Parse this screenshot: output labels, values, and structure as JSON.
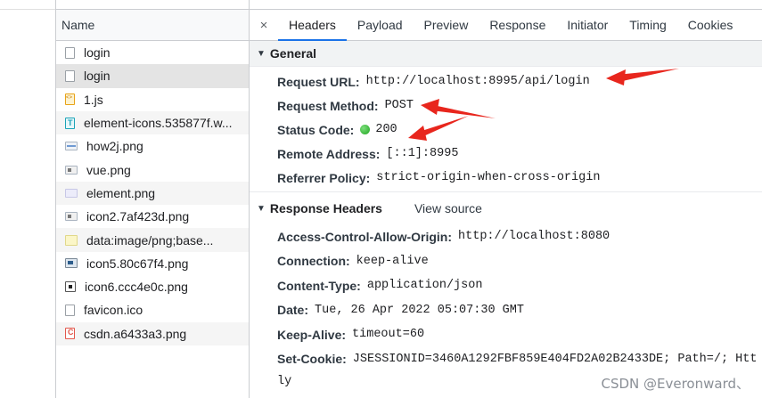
{
  "network_list": {
    "column_header": "Name",
    "items": [
      {
        "name": "login",
        "icon": "document-icon"
      },
      {
        "name": "login",
        "icon": "document-icon"
      },
      {
        "name": "1.js",
        "icon": "script-icon"
      },
      {
        "name": "element-icons.535877f.w...",
        "icon": "font-icon"
      },
      {
        "name": "how2j.png",
        "icon": "image-icon"
      },
      {
        "name": "vue.png",
        "icon": "image-icon"
      },
      {
        "name": "element.png",
        "icon": "image-icon"
      },
      {
        "name": "icon2.7af423d.png",
        "icon": "image-icon"
      },
      {
        "name": "data:image/png;base...",
        "icon": "image-icon"
      },
      {
        "name": "icon5.80c67f4.png",
        "icon": "image-icon"
      },
      {
        "name": "icon6.ccc4e0c.png",
        "icon": "image-icon"
      },
      {
        "name": "favicon.ico",
        "icon": "document-icon"
      },
      {
        "name": "csdn.a6433a3.png",
        "icon": "image-icon"
      }
    ]
  },
  "details": {
    "close_glyph": "×",
    "tabs": [
      {
        "label": "Headers",
        "active": true
      },
      {
        "label": "Payload"
      },
      {
        "label": "Preview"
      },
      {
        "label": "Response"
      },
      {
        "label": "Initiator"
      },
      {
        "label": "Timing"
      },
      {
        "label": "Cookies"
      }
    ],
    "general": {
      "title": "General",
      "rows": [
        {
          "key": "Request URL:",
          "value": "http://localhost:8995/api/login"
        },
        {
          "key": "Request Method:",
          "value": "POST"
        },
        {
          "key": "Status Code:",
          "value": "200"
        },
        {
          "key": "Remote Address:",
          "value": "[::1]:8995"
        },
        {
          "key": "Referrer Policy:",
          "value": "strict-origin-when-cross-origin"
        }
      ]
    },
    "response_headers": {
      "title": "Response Headers",
      "view_source": "View source",
      "rows": [
        {
          "key": "Access-Control-Allow-Origin:",
          "value": "http://localhost:8080"
        },
        {
          "key": "Connection:",
          "value": "keep-alive"
        },
        {
          "key": "Content-Type:",
          "value": "application/json"
        },
        {
          "key": "Date:",
          "value": "Tue, 26 Apr 2022 05:07:30 GMT"
        },
        {
          "key": "Keep-Alive:",
          "value": "timeout=60"
        },
        {
          "key": "Set-Cookie:",
          "value": "JSESSIONID=3460A1292FBF859E404FD2A02B2433DE; Path=/; Htt"
        }
      ],
      "set_cookie_wrap": "ly"
    }
  },
  "watermark": "CSDN @Everonward、",
  "colors": {
    "accent": "#1a73e8",
    "annotation_arrow": "#e8261d",
    "status_ok": "#1fa51f"
  }
}
